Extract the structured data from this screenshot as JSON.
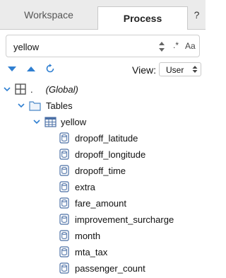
{
  "tabs": [
    {
      "label": "Workspace"
    },
    {
      "label": "Process"
    },
    {
      "label": "?"
    }
  ],
  "search": {
    "value": "yellow",
    "regex_label": ".*",
    "case_label": "Aa"
  },
  "toolbar": {
    "view_label": "View:",
    "view_value": "User"
  },
  "tree": {
    "global": {
      "dot": ".",
      "label": "(Global)"
    },
    "tables": {
      "label": "Tables"
    },
    "yellow": {
      "label": "yellow"
    },
    "columns": [
      "dropoff_latitude",
      "dropoff_longitude",
      "dropoff_time",
      "extra",
      "fare_amount",
      "improvement_surcharge",
      "month",
      "mta_tax",
      "passenger_count"
    ]
  },
  "colors": {
    "accent_blue": "#2f7fd1",
    "icon_gray": "#666666"
  }
}
